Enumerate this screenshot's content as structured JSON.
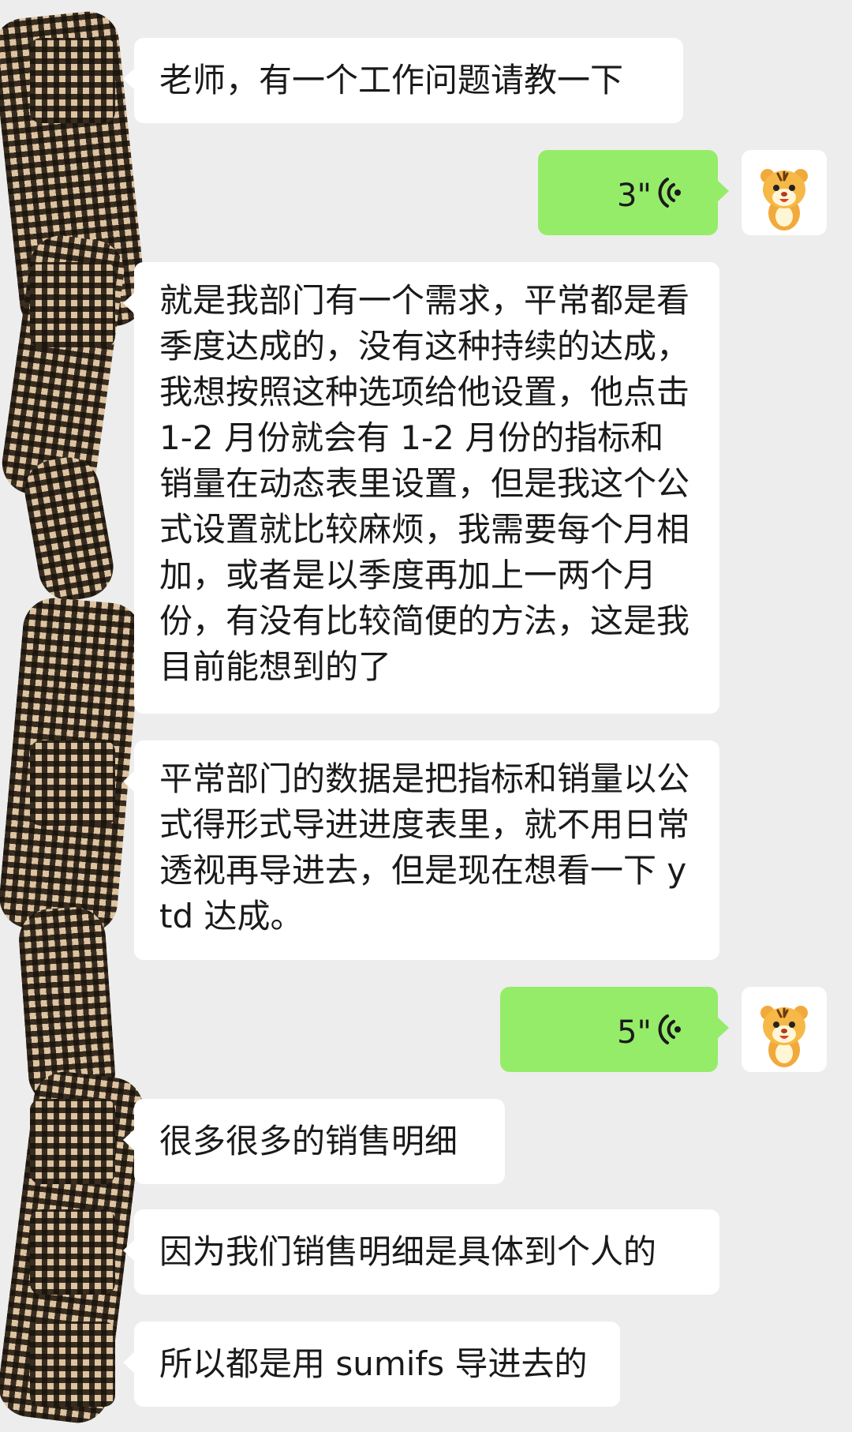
{
  "chat": {
    "messages": [
      {
        "sender": "contact",
        "type": "text",
        "text": "老师，有一个工作问题请教一下"
      },
      {
        "sender": "me",
        "type": "voice",
        "duration": "3\""
      },
      {
        "sender": "contact",
        "type": "text",
        "text": "就是我部门有一个需求，平常都是看季度达成的，没有这种持续的达成，我想按照这种选项给他设置，他点击 1-2 月份就会有 1-2 月份的指标和销量在动态表里设置，但是我这个公式设置就比较麻烦，我需要每个月相加，或者是以季度再加上一两个月份，有没有比较简便的方法，这是我目前能想到的了"
      },
      {
        "sender": "contact",
        "type": "text",
        "text": "平常部门的数据是把指标和销量以公式得形式导进进度表里，就不用日常透视再导进去，但是现在想看一下 ytd 达成。"
      },
      {
        "sender": "me",
        "type": "voice",
        "duration": "5\""
      },
      {
        "sender": "contact",
        "type": "text",
        "text": "很多很多的销售明细"
      },
      {
        "sender": "contact",
        "type": "text",
        "text": "因为我们销售明细是具体到个人的"
      },
      {
        "sender": "contact",
        "type": "text",
        "text": "所以都是用 sumifs 导进去的"
      }
    ]
  },
  "icons": {
    "voice": "voice-wave-icon",
    "my_avatar": "tiger-cartoon-avatar"
  },
  "colors": {
    "background": "#ededed",
    "incoming_bubble": "#ffffff",
    "outgoing_bubble": "#95ec69",
    "text": "#1a1a1a",
    "redaction": "#ddc3a0"
  }
}
